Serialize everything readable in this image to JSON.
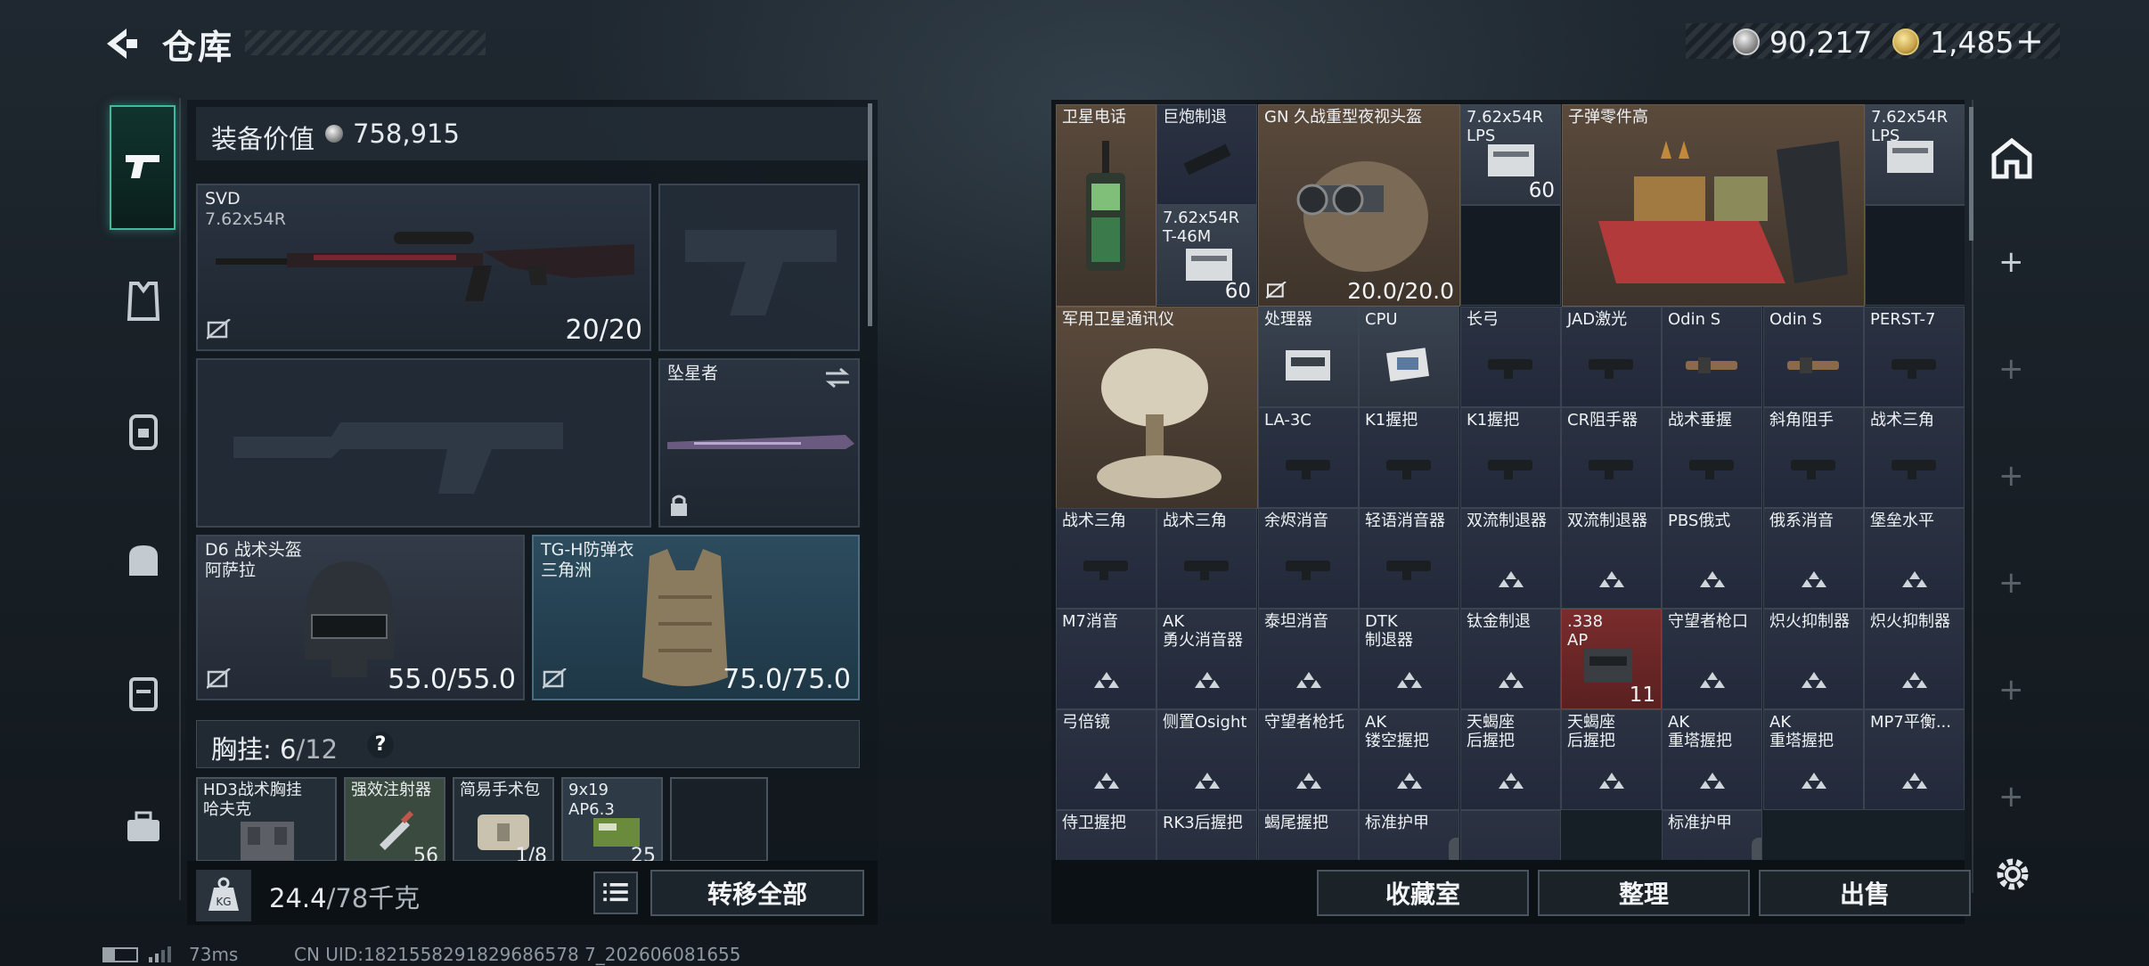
{
  "header": {
    "title": "仓库",
    "currency1": "90,217",
    "currency2": "1,485",
    "currency2_plus": "+"
  },
  "loadout": {
    "value_label": "装备价值",
    "value": "758,915",
    "primary": {
      "name": "SVD",
      "ammo": "7.62x54R",
      "durability": "20/20"
    },
    "melee": {
      "name": "坠星者"
    },
    "helmet": {
      "name": "D6 战术头盔",
      "sub": "阿萨拉",
      "durability": "55.0/55.0"
    },
    "armor": {
      "name": "TG-H防弹衣",
      "sub": "三角洲",
      "durability": "75.0/75.0"
    },
    "chest_label": "胸挂:",
    "chest_used": "6",
    "chest_total": "/12",
    "chest_help": "?",
    "chest_items": [
      {
        "name": "HD3战术胸挂\n哈夫克"
      },
      {
        "name": "强效注射器",
        "count": "56"
      },
      {
        "name": "简易手术包",
        "count": "1/8"
      },
      {
        "name": "9x19\nAP6.3",
        "count": "25"
      },
      {
        "name": ""
      }
    ],
    "weight": "24.4",
    "weight_max": "/78千克",
    "move_all": "转移全部"
  },
  "status": {
    "ping": "73ms",
    "uid": "CN UID:1821558291829686578 7_202606081655"
  },
  "stash": {
    "large": [
      {
        "name": "卫星电话"
      },
      {
        "name": "GN 久战重型夜视头盔",
        "durability": "20.0/20.0"
      },
      {
        "name": "子弹零件高"
      },
      {
        "name": "军用卫星通讯仪"
      }
    ],
    "cells": [
      {
        "name": "巨炮制退"
      },
      {
        "name": "7.62x54R\nT-46M",
        "count": "60"
      },
      {
        "name": "7.62x54R\nLPS",
        "count": "60"
      },
      {
        "name": "7.62x54R\nLPS"
      },
      {
        "name": "处理器"
      },
      {
        "name": "CPU"
      },
      {
        "name": "长弓"
      },
      {
        "name": "JAD激光"
      },
      {
        "name": "Odin S"
      },
      {
        "name": "Odin S"
      },
      {
        "name": "PERST-7"
      },
      {
        "name": "LA-3C"
      },
      {
        "name": "K1握把"
      },
      {
        "name": "K1握把"
      },
      {
        "name": "CR阻手器"
      },
      {
        "name": "战术垂握"
      },
      {
        "name": "斜角阻手"
      },
      {
        "name": "战术三角"
      },
      {
        "name": "战术三角"
      },
      {
        "name": "战术三角"
      },
      {
        "name": "余烬消音"
      },
      {
        "name": "轻语消音器"
      },
      {
        "name": "双流制退器"
      },
      {
        "name": "双流制退器"
      },
      {
        "name": "PBS俄式"
      },
      {
        "name": "俄系消音"
      },
      {
        "name": "堡垒水平"
      },
      {
        "name": "M7消音"
      },
      {
        "name": "AK\n勇火消音器"
      },
      {
        "name": "泰坦消音"
      },
      {
        "name": "DTK\n制退器"
      },
      {
        "name": "钛金制退"
      },
      {
        "name": ".338\nAP",
        "count": "11"
      },
      {
        "name": "守望者枪口"
      },
      {
        "name": "炽火抑制器"
      },
      {
        "name": "炽火抑制器"
      },
      {
        "name": "弓倍镜"
      },
      {
        "name": "侧置Osight"
      },
      {
        "name": "守望者枪托"
      },
      {
        "name": "AK\n镂空握把"
      },
      {
        "name": "天蝎座\n后握把"
      },
      {
        "name": "天蝎座\n后握把"
      },
      {
        "name": "AK\n重塔握把"
      },
      {
        "name": "AK\n重塔握把"
      },
      {
        "name": "MP7平衡..."
      },
      {
        "name": "侍卫握把"
      },
      {
        "name": "RK3后握把"
      },
      {
        "name": "蝎尾握把"
      },
      {
        "name": "标准护甲"
      },
      {
        "name": ""
      },
      {
        "name": "标准护甲"
      }
    ],
    "buttons": {
      "collection": "收藏室",
      "sort": "整理",
      "sell": "出售"
    }
  }
}
